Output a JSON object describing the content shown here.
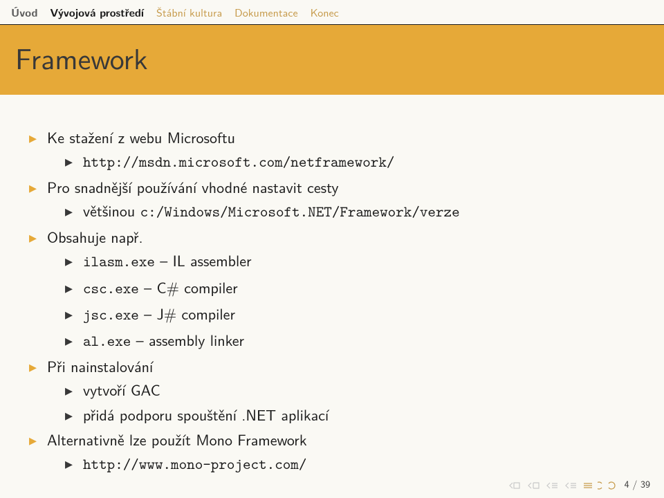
{
  "nav": {
    "items": [
      {
        "label": "Úvod",
        "state": "semi"
      },
      {
        "label": "Vývojová prostředí",
        "state": "active"
      },
      {
        "label": "Štábní kultura",
        "state": "inactive"
      },
      {
        "label": "Dokumentace",
        "state": "inactive"
      },
      {
        "label": "Konec",
        "state": "inactive"
      }
    ]
  },
  "title": "Framework",
  "content": {
    "i1": "Ke stažení z webu Microsoftu",
    "i1a": "http://msdn.microsoft.com/netframework/",
    "i2": "Pro snadnější používání vhodné nastavit cesty",
    "i2a": "většinou ",
    "i2a_tt": "c:/Windows/Microsoft.NET/Framework/verze",
    "i3": "Obsahuje např.",
    "i3a_tt": "ilasm.exe",
    "i3a": " – IL assembler",
    "i3b_tt": "csc.exe",
    "i3b": " – C# compiler",
    "i3c_tt": "jsc.exe",
    "i3c": " – J# compiler",
    "i3d_tt": "al.exe",
    "i3d": " – assembly linker",
    "i4": "Při nainstalování",
    "i4a": "vytvoří GAC",
    "i4b": "přidá podporu spouštění .NET aplikací",
    "i5": "Alternativně lze použít Mono Framework",
    "i5a": "http://www.mono-project.com/"
  },
  "footer": {
    "page": "4 / 39"
  }
}
